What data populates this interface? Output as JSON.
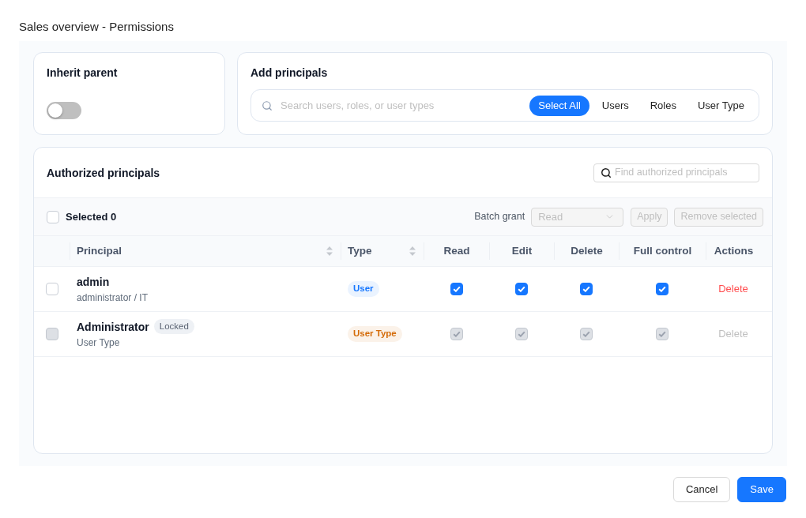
{
  "dialog": {
    "title": "Sales overview - Permissions"
  },
  "inherit_parent": {
    "title": "Inherit parent",
    "on": false
  },
  "add_principals": {
    "title": "Add principals",
    "search": {
      "placeholder": "Search users, roles, or user types"
    },
    "filters": [
      {
        "label": "Select All",
        "selected": true
      },
      {
        "label": "Users",
        "selected": false
      },
      {
        "label": "Roles",
        "selected": false
      },
      {
        "label": "User Type",
        "selected": false
      }
    ]
  },
  "authorized_principals": {
    "title": "Authorized principals",
    "search": {
      "placeholder": "Find authorized principals"
    },
    "toolbar": {
      "select_all": {
        "checked": false
      },
      "selected_count": "Selected 0",
      "batch_grant": {
        "label": "Batch grant",
        "value": "Read",
        "disabled": true
      },
      "buttons": [
        {
          "label": "Apply",
          "disabled": true
        },
        {
          "label": "Remove selected",
          "disabled": true
        }
      ]
    },
    "columns": [
      {
        "label": "Principal",
        "sortable": true
      },
      {
        "label": "Type",
        "sortable": true
      },
      {
        "label": "Read",
        "sortable": false
      },
      {
        "label": "Edit",
        "sortable": false
      },
      {
        "label": "Delete",
        "sortable": false
      },
      {
        "label": "Full control",
        "sortable": false
      },
      {
        "label": "Actions",
        "sortable": false
      }
    ],
    "rows": [
      {
        "checked": false,
        "disabled": false,
        "name": "admin",
        "subtitle": "administrator / IT",
        "type": {
          "label": "User",
          "color": "#1677ff"
        },
        "permissions": [
          {
            "checked": true,
            "disabled": false
          },
          {
            "checked": true,
            "disabled": false
          },
          {
            "checked": true,
            "disabled": false
          },
          {
            "checked": true,
            "disabled": false
          }
        ],
        "action": {
          "label": "Delete",
          "disabled": false
        }
      },
      {
        "checked": false,
        "disabled": true,
        "name": "Administrator",
        "tag": "Locked",
        "subtitle": "User Type",
        "type": {
          "label": "User Type",
          "color": "#d46b08"
        },
        "permissions": [
          {
            "checked": true,
            "disabled": true
          },
          {
            "checked": true,
            "disabled": true
          },
          {
            "checked": true,
            "disabled": true
          },
          {
            "checked": true,
            "disabled": true
          }
        ],
        "action": {
          "label": "Delete",
          "disabled": true
        }
      }
    ]
  },
  "footer": {
    "buttons": [
      {
        "label": "Cancel",
        "kind": "default"
      },
      {
        "label": "Save",
        "kind": "primary"
      }
    ]
  }
}
